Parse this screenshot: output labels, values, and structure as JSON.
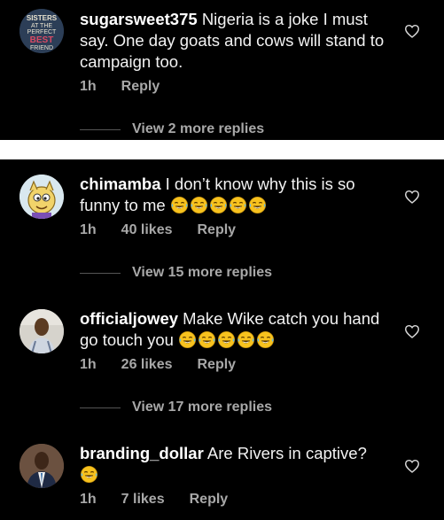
{
  "comments": [
    {
      "username": "sugarsweet375",
      "text": "Nigeria is a joke I must say. One  day goats and cows will stand to campaign too.",
      "time": "1h",
      "likes": "",
      "reply": "Reply",
      "avatar_text": [
        "SISTERS",
        "AT THE",
        "PERFECT",
        "BEST",
        "FRIEND"
      ],
      "view_more": "View 2 more replies"
    },
    {
      "username": "chimamba",
      "text": "I don’t know why this is so funny to me",
      "emoji_count": 5,
      "time": "1h",
      "likes": "40 likes",
      "reply": "Reply",
      "view_more": "View 15 more replies"
    },
    {
      "username": "officialjowey",
      "text": "Make Wike catch you hand go touch you",
      "emoji_count": 5,
      "time": "1h",
      "likes": "26 likes",
      "reply": "Reply",
      "view_more": "View 17 more replies"
    },
    {
      "username": "branding_dollar",
      "text": "Are Rivers in captive?",
      "emoji_count": 1,
      "time": "1h",
      "likes": "7 likes",
      "reply": "Reply"
    }
  ],
  "colors": {
    "background": "#000000",
    "meta_text": "#a8a8a8",
    "emoji": "#f7c21e",
    "divider": "#ffffff"
  },
  "icons": {
    "like": "heart-outline-icon",
    "emoji": "face-with-tears-of-joy-icon"
  }
}
